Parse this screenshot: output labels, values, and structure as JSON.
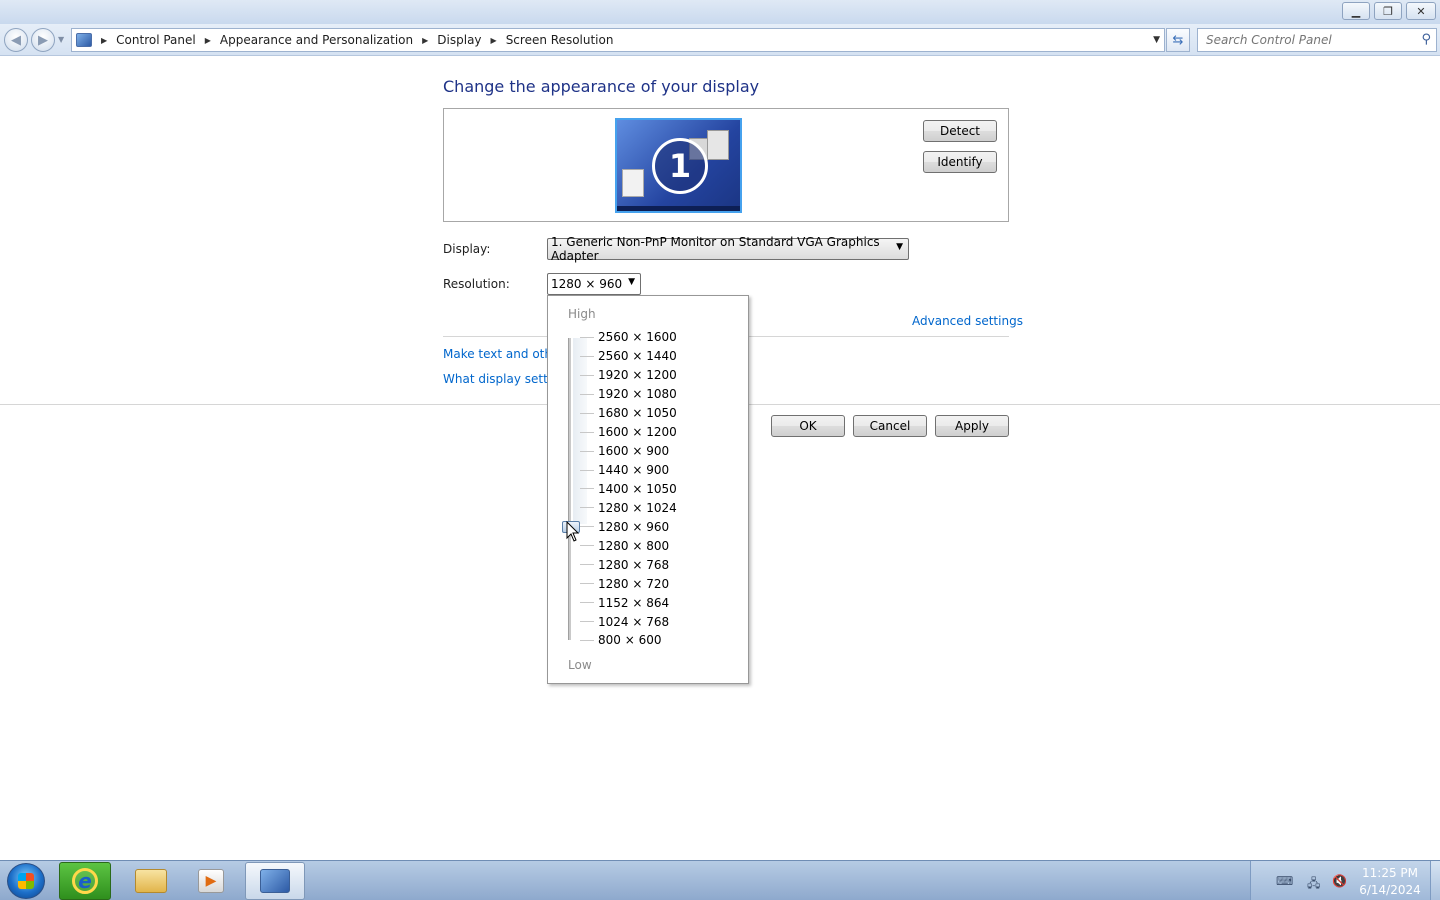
{
  "window": {
    "minimize_icon": "minimize-icon",
    "maximize_icon": "restore-icon",
    "close_icon": "close-icon"
  },
  "address_bar": {
    "breadcrumbs": [
      "Control Panel",
      "Appearance and Personalization",
      "Display",
      "Screen Resolution"
    ],
    "search_placeholder": "Search Control Panel"
  },
  "page": {
    "heading": "Change the appearance of your display",
    "monitor_number": "1",
    "detect_label": "Detect",
    "identify_label": "Identify",
    "display_label": "Display:",
    "display_value": "1. Generic Non-PnP Monitor on Standard VGA Graphics Adapter",
    "resolution_label": "Resolution:",
    "resolution_value": "1280 × 960",
    "advanced_link": "Advanced settings",
    "link_text_size": "Make text and other items larger or smaller",
    "link_display_settings": "What display settings should I choose?",
    "ok_label": "OK",
    "cancel_label": "Cancel",
    "apply_label": "Apply"
  },
  "resolution_dropdown": {
    "high_label": "High",
    "low_label": "Low",
    "options": [
      "2560 × 1600",
      "2560 × 1440",
      "1920 × 1200",
      "1920 × 1080",
      "1680 × 1050",
      "1600 × 1200",
      "1600 × 900",
      "1440 × 900",
      "1400 × 1050",
      "1280 × 1024",
      "1280 × 960",
      "1280 × 800",
      "1280 × 768",
      "1280 × 720",
      "1152 × 864",
      "1024 × 768",
      "800 × 600"
    ],
    "selected": "1280 × 960"
  },
  "taskbar": {
    "time": "11:25 PM",
    "date": "6/14/2024"
  }
}
